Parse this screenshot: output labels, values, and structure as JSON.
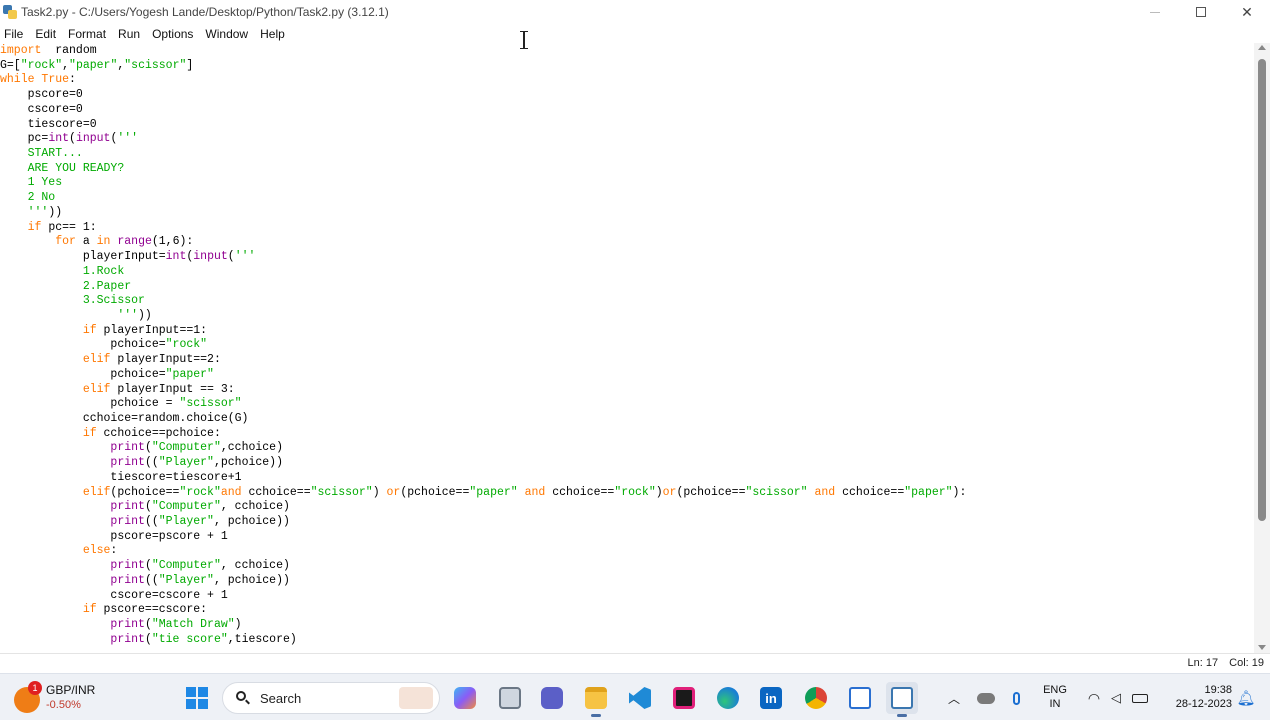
{
  "window": {
    "title": "Task2.py - C:/Users/Yogesh Lande/Desktop/Python/Task2.py (3.12.1)"
  },
  "menu": [
    "File",
    "Edit",
    "Format",
    "Run",
    "Options",
    "Window",
    "Help"
  ],
  "statusbar": {
    "line": "Ln: 17",
    "col": "Col: 19"
  },
  "taskbar": {
    "widget": {
      "name": "GBP/INR",
      "change": "-0.50%",
      "badge": "1"
    },
    "search_label": "Search",
    "language": {
      "top": "ENG",
      "bottom": "IN"
    },
    "clock": {
      "time": "19:38",
      "date": "28-12-2023"
    },
    "icons": [
      "start-icon",
      "search-icon",
      "mail-icon",
      "task-view-icon",
      "teams-icon",
      "file-explorer-icon",
      "vscode-icon",
      "jetbrains-icon",
      "edge-icon",
      "linkedin-icon",
      "chrome-icon",
      "notepad-icon",
      "idle-python-icon"
    ]
  },
  "colors": {
    "keyword": "#ff7700",
    "string": "#00aa00",
    "builtin": "#900090",
    "accent": "#1e88e5"
  },
  "code": [
    [
      [
        "kw",
        "import"
      ],
      [
        "",
        "  random"
      ]
    ],
    [
      [
        "",
        "G=["
      ],
      [
        "st",
        "\"rock\""
      ],
      [
        "",
        ","
      ],
      [
        "st",
        "\"paper\""
      ],
      [
        "",
        ","
      ],
      [
        "st",
        "\"scissor\""
      ],
      [
        "",
        "]"
      ]
    ],
    [
      [
        "kw",
        "while"
      ],
      [
        "",
        " "
      ],
      [
        "kw",
        "True"
      ],
      [
        "",
        ":"
      ]
    ],
    [
      [
        "",
        "    pscore=0"
      ]
    ],
    [
      [
        "",
        "    cscore=0"
      ]
    ],
    [
      [
        "",
        "    tiescore=0"
      ]
    ],
    [
      [
        "",
        "    pc="
      ],
      [
        "bi",
        "int"
      ],
      [
        "",
        "("
      ],
      [
        "bi",
        "input"
      ],
      [
        "",
        "("
      ],
      [
        "st",
        "'''"
      ]
    ],
    [
      [
        "st",
        "    START..."
      ]
    ],
    [
      [
        "st",
        "    ARE YOU READY?"
      ]
    ],
    [
      [
        "st",
        "    1 Yes"
      ]
    ],
    [
      [
        "st",
        "    2 No"
      ]
    ],
    [
      [
        "st",
        "    '''"
      ],
      [
        "",
        "))"
      ]
    ],
    [
      [
        "",
        ""
      ],
      [
        "kw",
        "    if"
      ],
      [
        "",
        " pc== 1:"
      ]
    ],
    [
      [
        "kw",
        "        for"
      ],
      [
        "",
        " a "
      ],
      [
        "kw",
        "in"
      ],
      [
        "",
        " "
      ],
      [
        "bi",
        "range"
      ],
      [
        "",
        "(1,6):"
      ]
    ],
    [
      [
        "",
        "            playerInput="
      ],
      [
        "bi",
        "int"
      ],
      [
        "",
        "("
      ],
      [
        "bi",
        "input"
      ],
      [
        "",
        "("
      ],
      [
        "st",
        "'''"
      ]
    ],
    [
      [
        "st",
        "            1.Rock"
      ]
    ],
    [
      [
        "st",
        "            2.Paper"
      ]
    ],
    [
      [
        "st",
        "            3.Scissor"
      ]
    ],
    [
      [
        "st",
        "                 '''"
      ],
      [
        "",
        "))"
      ]
    ],
    [
      [
        "kw",
        "            if"
      ],
      [
        "",
        " playerInput==1:"
      ]
    ],
    [
      [
        "",
        "                pchoice="
      ],
      [
        "st",
        "\"rock\""
      ]
    ],
    [
      [
        "kw",
        "            elif"
      ],
      [
        "",
        " playerInput==2:"
      ]
    ],
    [
      [
        "",
        "                pchoice="
      ],
      [
        "st",
        "\"paper\""
      ]
    ],
    [
      [
        "kw",
        "            elif"
      ],
      [
        "",
        " playerInput == 3:"
      ]
    ],
    [
      [
        "",
        "                pchoice = "
      ],
      [
        "st",
        "\"scissor\""
      ]
    ],
    [
      [
        "",
        "            cchoice=random.choice(G)"
      ]
    ],
    [
      [
        "kw",
        "            if"
      ],
      [
        "",
        " cchoice==pchoice:"
      ]
    ],
    [
      [
        "bi",
        "                print"
      ],
      [
        "",
        "("
      ],
      [
        "st",
        "\"Computer\""
      ],
      [
        "",
        ",cchoice)"
      ]
    ],
    [
      [
        "bi",
        "                print"
      ],
      [
        "",
        "(("
      ],
      [
        "st",
        "\"Player\""
      ],
      [
        "",
        ",pchoice))"
      ]
    ],
    [
      [
        "",
        "                tiescore=tiescore+1"
      ]
    ],
    [
      [
        "kw",
        "            elif"
      ],
      [
        "",
        "(pchoice=="
      ],
      [
        "st",
        "\"rock\""
      ],
      [
        "kw",
        "and"
      ],
      [
        "",
        " cchoice=="
      ],
      [
        "st",
        "\"scissor\""
      ],
      [
        "",
        ") "
      ],
      [
        "kw",
        "or"
      ],
      [
        "",
        "(pchoice=="
      ],
      [
        "st",
        "\"paper\""
      ],
      [
        "",
        " "
      ],
      [
        "kw",
        "and"
      ],
      [
        "",
        " cchoice=="
      ],
      [
        "st",
        "\"rock\""
      ],
      [
        "",
        ")"
      ],
      [
        "kw",
        "or"
      ],
      [
        "",
        "(pchoice=="
      ],
      [
        "st",
        "\"scissor\""
      ],
      [
        "",
        " "
      ],
      [
        "kw",
        "and"
      ],
      [
        "",
        " cchoice=="
      ],
      [
        "st",
        "\"paper\""
      ],
      [
        "",
        "):"
      ]
    ],
    [
      [
        "bi",
        "                print"
      ],
      [
        "",
        "("
      ],
      [
        "st",
        "\"Computer\""
      ],
      [
        "",
        ", cchoice)"
      ]
    ],
    [
      [
        "bi",
        "                print"
      ],
      [
        "",
        "(("
      ],
      [
        "st",
        "\"Player\""
      ],
      [
        "",
        ", pchoice))"
      ]
    ],
    [
      [
        "",
        "                pscore=pscore + 1"
      ]
    ],
    [
      [
        "kw",
        "            else"
      ],
      [
        "",
        ":"
      ]
    ],
    [
      [
        "bi",
        "                print"
      ],
      [
        "",
        "("
      ],
      [
        "st",
        "\"Computer\""
      ],
      [
        "",
        ", cchoice)"
      ]
    ],
    [
      [
        "bi",
        "                print"
      ],
      [
        "",
        "(("
      ],
      [
        "st",
        "\"Player\""
      ],
      [
        "",
        ", pchoice))"
      ]
    ],
    [
      [
        "",
        "                cscore=cscore + 1"
      ]
    ],
    [
      [
        "kw",
        "            if"
      ],
      [
        "",
        " pscore==cscore:"
      ]
    ],
    [
      [
        "bi",
        "                print"
      ],
      [
        "",
        "("
      ],
      [
        "st",
        "\"Match Draw\""
      ],
      [
        "",
        ")"
      ]
    ],
    [
      [
        "bi",
        "                print"
      ],
      [
        "",
        "("
      ],
      [
        "st",
        "\"tie score\""
      ],
      [
        "",
        ",tiescore)"
      ]
    ]
  ]
}
